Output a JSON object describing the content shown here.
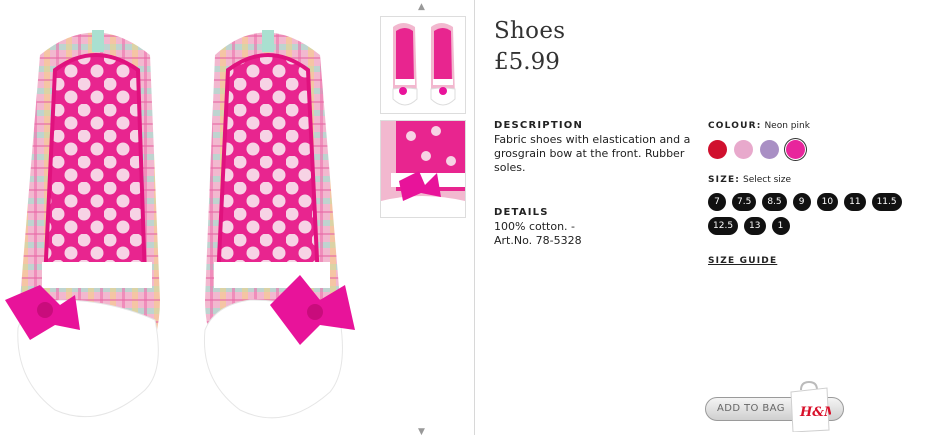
{
  "product": {
    "title": "Shoes",
    "price": "£5.99"
  },
  "description": {
    "heading": "DESCRIPTION",
    "text": "Fabric shoes with elastication and a grosgrain bow at the front. Rubber soles."
  },
  "details": {
    "heading": "DETAILS",
    "lines": [
      "100% cotton. -",
      "Art.No. 78-5328"
    ]
  },
  "colour": {
    "label": "COLOUR:",
    "selected": "Neon pink",
    "swatches": [
      {
        "name": "red",
        "color": "#d0102e"
      },
      {
        "name": "light-pink",
        "color": "#e8a9cc"
      },
      {
        "name": "lilac",
        "color": "#a98fc4"
      },
      {
        "name": "neon-pink",
        "color": "#e8259c",
        "selected": true
      }
    ]
  },
  "size": {
    "label": "SIZE:",
    "selected": "Select size",
    "options": [
      "7",
      "7.5",
      "8.5",
      "9",
      "10",
      "11",
      "11.5",
      "12.5",
      "13",
      "1"
    ]
  },
  "size_guide": "SIZE GUIDE",
  "cart": {
    "add_label": "ADD TO BAG",
    "brand": "H&M"
  },
  "thumbnails": {
    "up_arrow": "▲",
    "down_arrow": "▼"
  }
}
